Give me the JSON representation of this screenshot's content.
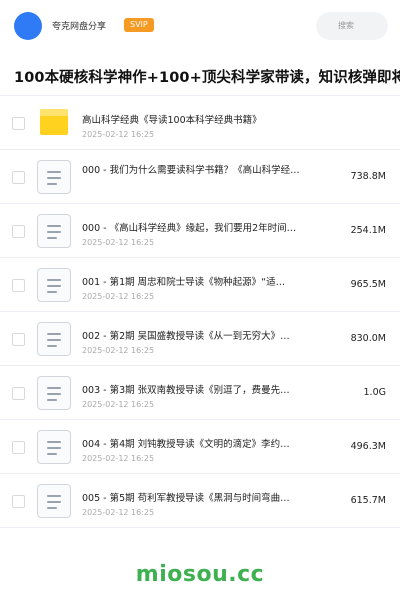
{
  "header": {
    "user_name": "夸克网盘分享",
    "badge": "SVIP",
    "search_placeholder": "搜索",
    "accent_color": "#2f7bf6"
  },
  "page": {
    "title": "100本硬核科学神作+100+顶尖科学家带读，知识核弹即将"
  },
  "files": [
    {
      "type": "folder",
      "name": "高山科学经典《导读100本科学经典书籍》",
      "date": "2025-02-12 16:25",
      "size": ""
    },
    {
      "type": "file",
      "name": "000 - 我们为什么需要读科学书籍？《高山科学经…",
      "date": "",
      "size": "738.8M"
    },
    {
      "type": "file",
      "name": "000 - 《高山科学经典》缘起，我们要用2年时间…",
      "date": "2025-02-12 16:25",
      "size": "254.1M"
    },
    {
      "type": "file",
      "name": "001 - 第1期 周忠和院士导读《物种起源》“适…",
      "date": "2025-02-12 16:25",
      "size": "965.5M"
    },
    {
      "type": "file",
      "name": "002 - 第2期 吴国盛教授导读《从一到无穷大》…",
      "date": "2025-02-12 16:25",
      "size": "830.0M"
    },
    {
      "type": "file",
      "name": "003 - 第3期 张双南教授导读《别逗了，费曼先…",
      "date": "2025-02-12 16:25",
      "size": "1.0G"
    },
    {
      "type": "file",
      "name": "004 - 第4期 刘钝教授导读《文明的滴定》李约…",
      "date": "2025-02-12 16:25",
      "size": "496.3M"
    },
    {
      "type": "file",
      "name": "005 - 第5期 苟利军教授导读《黑洞与时间弯曲…",
      "date": "2025-02-12 16:25",
      "size": "615.7M"
    }
  ],
  "footer": {
    "brand": "miosou.cc",
    "brand_color": "#3db04f"
  }
}
